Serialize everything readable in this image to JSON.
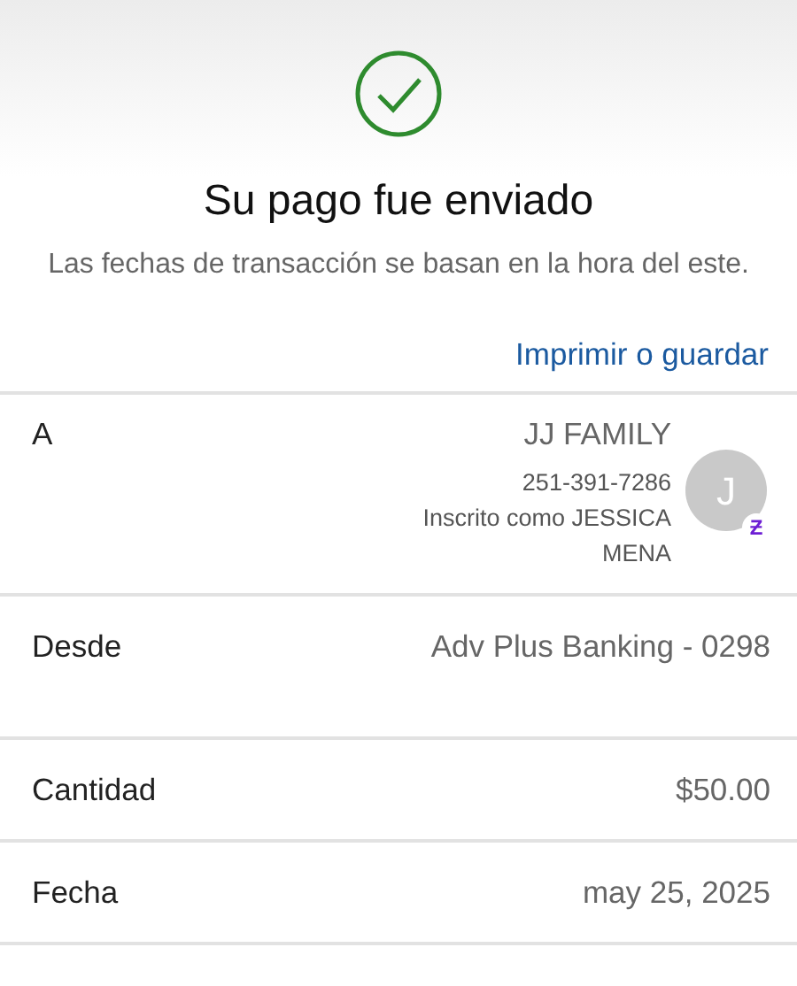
{
  "header": {
    "title": "Su pago fue enviado",
    "subtitle": "Las fechas de transacción se basan en la hora del este.",
    "link": "Imprimir o guardar"
  },
  "details": [
    {
      "kind": "recipient",
      "label": "A",
      "value": "JJ FAMILY",
      "lines": [
        "251-391-7286",
        "Inscrito como JESSICA MENA"
      ],
      "avatar": "J",
      "badge": "Ƶ"
    },
    {
      "kind": "plain",
      "label": "Desde",
      "value": "Adv Plus Banking - 0298"
    },
    {
      "kind": "plain",
      "label": "Cantidad",
      "value": "$50.00"
    },
    {
      "kind": "plain",
      "label": "Fecha",
      "value": "may 25, 2025"
    }
  ]
}
